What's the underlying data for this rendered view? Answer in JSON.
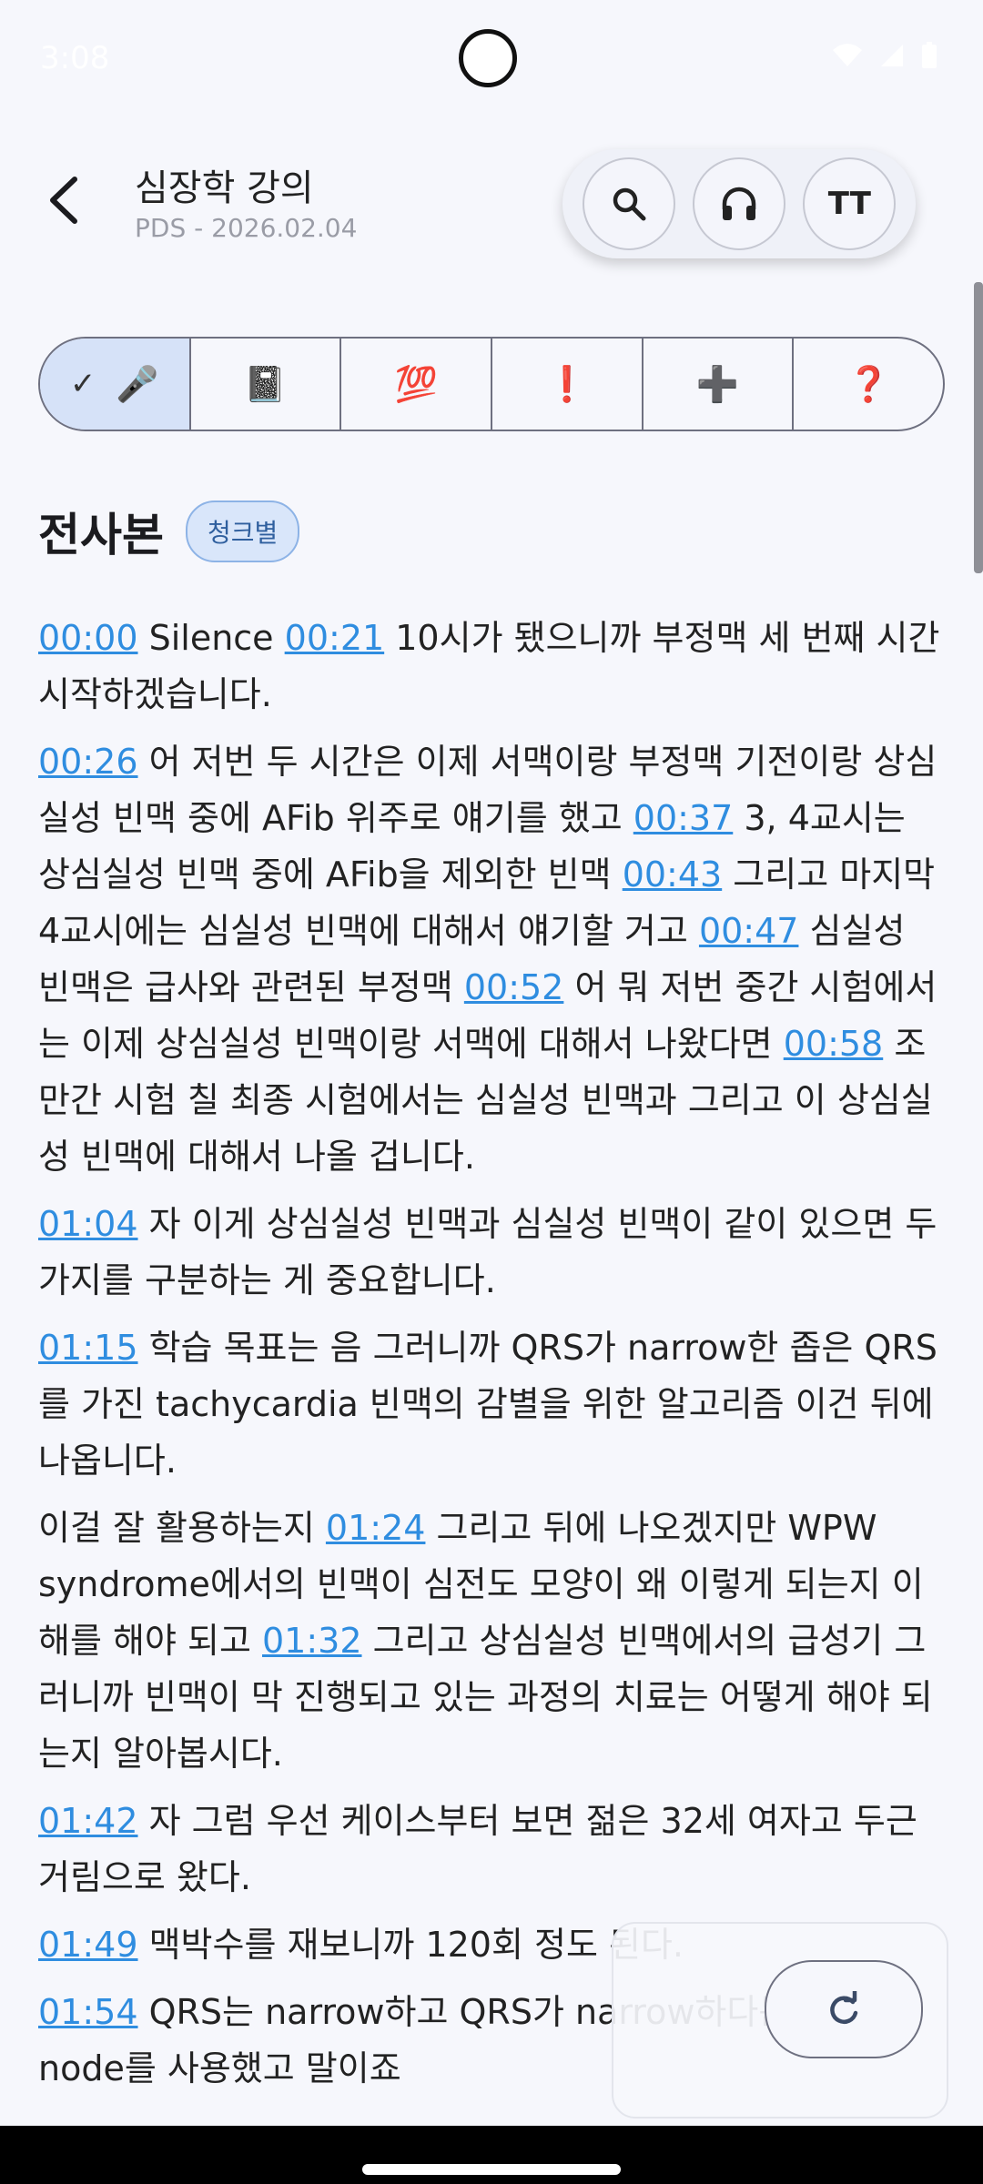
{
  "status_bar": {
    "time": "3:08"
  },
  "header": {
    "title": "심장학 강의",
    "subtitle": "PDS - 2026.02.04",
    "text_size_label": "TT"
  },
  "filters": [
    {
      "icon": "microphone-icon",
      "glyph": "🎤",
      "selected": true
    },
    {
      "icon": "notebook-icon",
      "glyph": "📓"
    },
    {
      "icon": "hundred-points-icon",
      "glyph": "💯"
    },
    {
      "icon": "exclamation-icon",
      "glyph": "❗"
    },
    {
      "icon": "plus-icon",
      "glyph": "➕"
    },
    {
      "icon": "question-icon",
      "glyph": "❓"
    }
  ],
  "section": {
    "title": "전사본",
    "chip": "청크별"
  },
  "transcript": [
    {
      "segments": [
        {
          "ts": "00:00",
          "text": " Silence "
        },
        {
          "ts": "00:21",
          "text": " 10시가 됐으니까 부정맥 세 번째 시간 시작하겠습니다."
        }
      ]
    },
    {
      "segments": [
        {
          "ts": "00:26",
          "text": " 어 저번 두 시간은 이제 서맥이랑 부정맥 기전이랑 상심실성 빈맥 중에 AFib 위주로 얘기를 했고 "
        },
        {
          "ts": "00:37",
          "text": " 3, 4교시는 상심실성 빈맥 중에 AFib을 제외한 빈맥 "
        },
        {
          "ts": "00:43",
          "text": " 그리고 마지막 4교시에는 심실성 빈맥에 대해서 얘기할 거고 "
        },
        {
          "ts": "00:47",
          "text": " 심실성 빈맥은 급사와 관련된 부정맥 "
        },
        {
          "ts": "00:52",
          "text": " 어 뭐 저번 중간 시험에서는 이제 상심실성 빈맥이랑 서맥에 대해서 나왔다면 "
        },
        {
          "ts": "00:58",
          "text": " 조만간 시험 칠 최종 시험에서는 심실성 빈맥과 그리고 이 상심실성 빈맥에 대해서 나올 겁니다."
        }
      ]
    },
    {
      "segments": [
        {
          "ts": "01:04",
          "text": " 자 이게 상심실성 빈맥과 심실성 빈맥이 같이 있으면 두 가지를 구분하는 게 중요합니다."
        }
      ]
    },
    {
      "segments": [
        {
          "ts": "01:15",
          "text": " 학습 목표는 음 그러니까 QRS가 narrow한 좁은 QRS를 가진 tachycardia 빈맥의 감별을 위한 알고리즘 이건 뒤에 나옵니다."
        }
      ]
    },
    {
      "segments": [
        {
          "ts": "",
          "text": "이걸 잘 활용하는지 "
        },
        {
          "ts": "01:24",
          "text": " 그리고 뒤에 나오겠지만 WPW syndrome에서의 빈맥이 심전도 모양이 왜 이렇게 되는지 이해를 해야 되고 "
        },
        {
          "ts": "01:32",
          "text": " 그리고 상심실성 빈맥에서의 급성기 그러니까 빈맥이 막 진행되고 있는 과정의 치료는 어떻게 해야 되는지 알아봅시다."
        }
      ]
    },
    {
      "segments": [
        {
          "ts": "01:42",
          "text": " 자 그럼 우선 케이스부터 보면 젊은 32세 여자고 두근거림으로 왔다."
        }
      ]
    },
    {
      "segments": [
        {
          "ts": "01:49",
          "text": " 맥박수를 재보니까 120회 정도 된다."
        }
      ]
    },
    {
      "segments": [
        {
          "ts": "01:54",
          "text": " QRS는 narrow하고 QRS가 narrow하다는 거는 AV node를 사용했고 말이죠"
        }
      ]
    }
  ]
}
